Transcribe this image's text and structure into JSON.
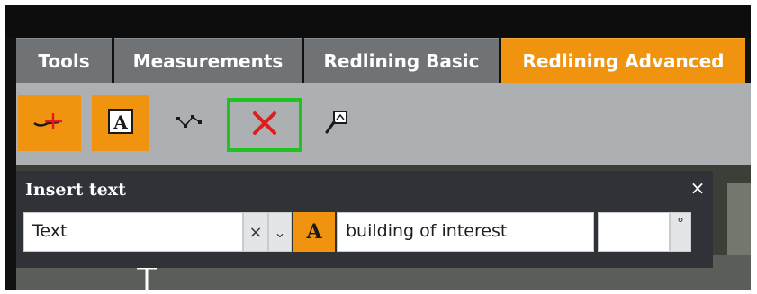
{
  "tabs": [
    {
      "label": "Tools",
      "active": false
    },
    {
      "label": "Measurements",
      "active": false
    },
    {
      "label": "Redlining Basic",
      "active": false
    },
    {
      "label": "Redlining Advanced",
      "active": true
    }
  ],
  "toolbar": {
    "tools": [
      {
        "icon": "draw-line-icon",
        "state": "active"
      },
      {
        "icon": "text-tool-icon",
        "state": "active"
      },
      {
        "icon": "vertex-edit-icon",
        "state": "normal"
      },
      {
        "icon": "delete-icon",
        "state": "highlighted"
      },
      {
        "icon": "zoom-to-annotation-icon",
        "state": "normal"
      }
    ],
    "highlight_color": "#1fc21f",
    "active_color": "#f0940f"
  },
  "insert_panel": {
    "title": "Insert text",
    "close_symbol": "×",
    "type_value": "Text",
    "clear_symbol": "×",
    "dropdown_symbol": "⌄",
    "font_button_glyph": "A",
    "text_value": "building of interest",
    "size_value": "",
    "rotation_symbol": "°"
  }
}
